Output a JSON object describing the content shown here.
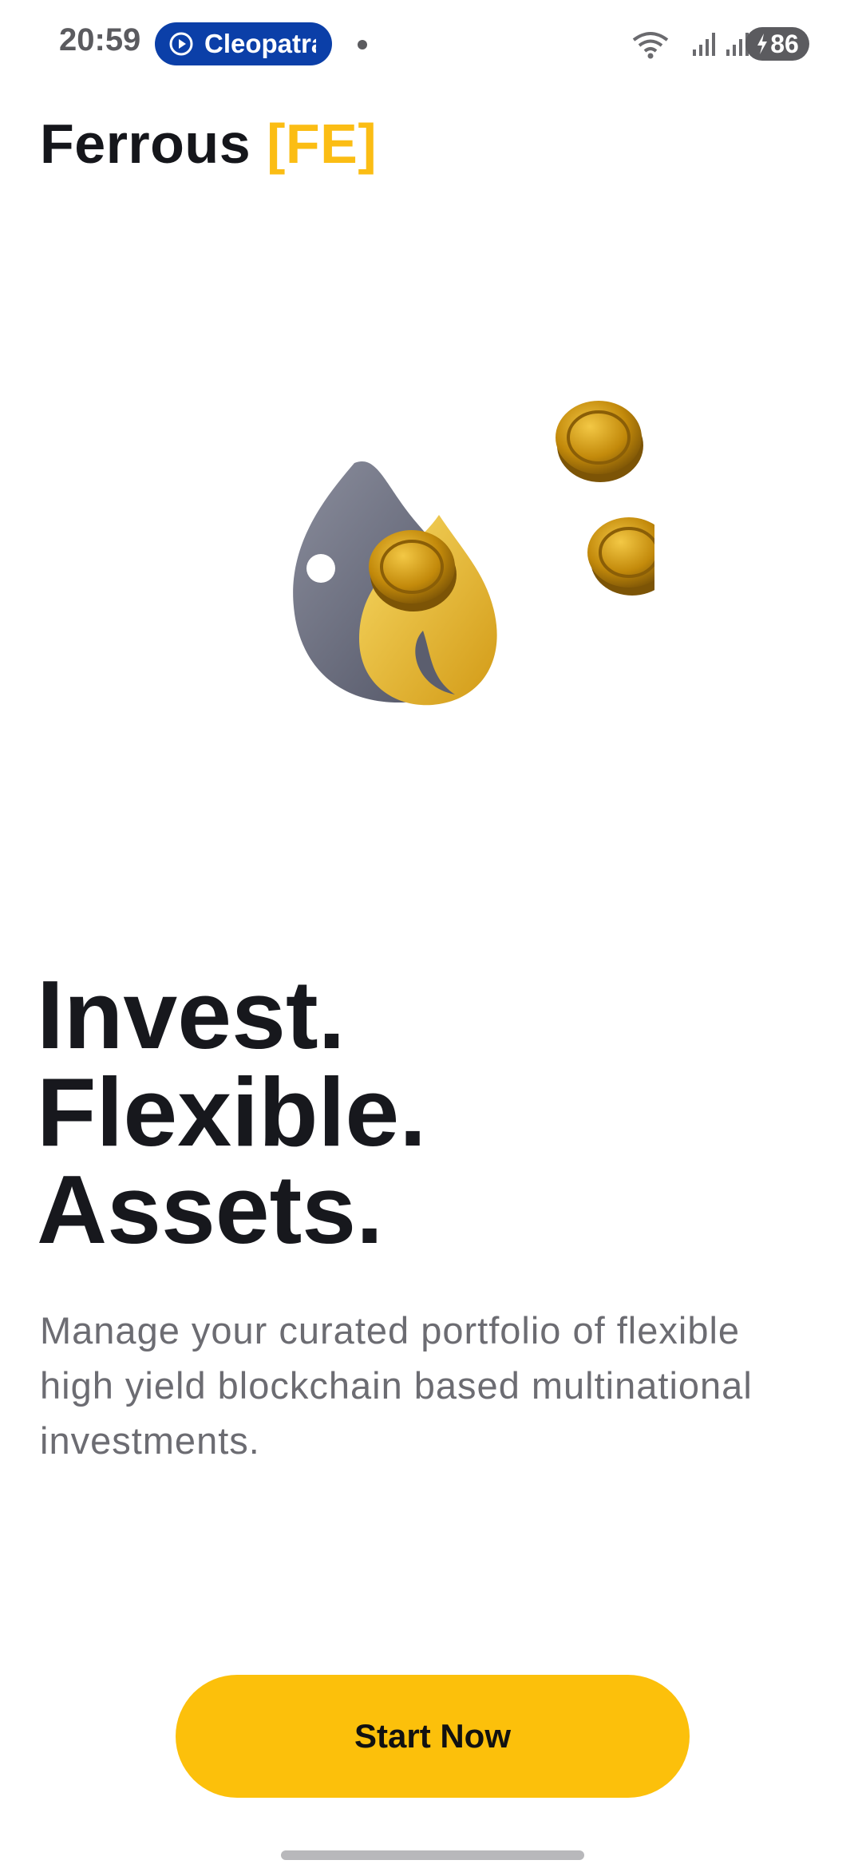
{
  "status_bar": {
    "time": "20:59",
    "app_pill_label": "Cleopatra",
    "battery_level": "86",
    "app_pill_color": "#0b3fa8",
    "icons": [
      "notification-dot-icon",
      "wifi-icon",
      "signal-icon",
      "battery-charging-icon"
    ]
  },
  "brand": {
    "name": "Ferrous",
    "ticker": "[FE]",
    "accent_color": "#fbbd14"
  },
  "hero": {
    "image": "flame-with-coins-illustration",
    "colors": {
      "flame_dark": "#6f7282",
      "flame_gold": "#f0c33a",
      "coin_gold": "#c8960f"
    }
  },
  "headline": {
    "line1": "Invest.",
    "line2": "Flexible.",
    "line3": "Assets."
  },
  "description": {
    "text": "Manage your curated portfolio of flexible high yield blockchain based multinational investments."
  },
  "cta": {
    "label": "Start Now",
    "color": "#fcc00b"
  }
}
